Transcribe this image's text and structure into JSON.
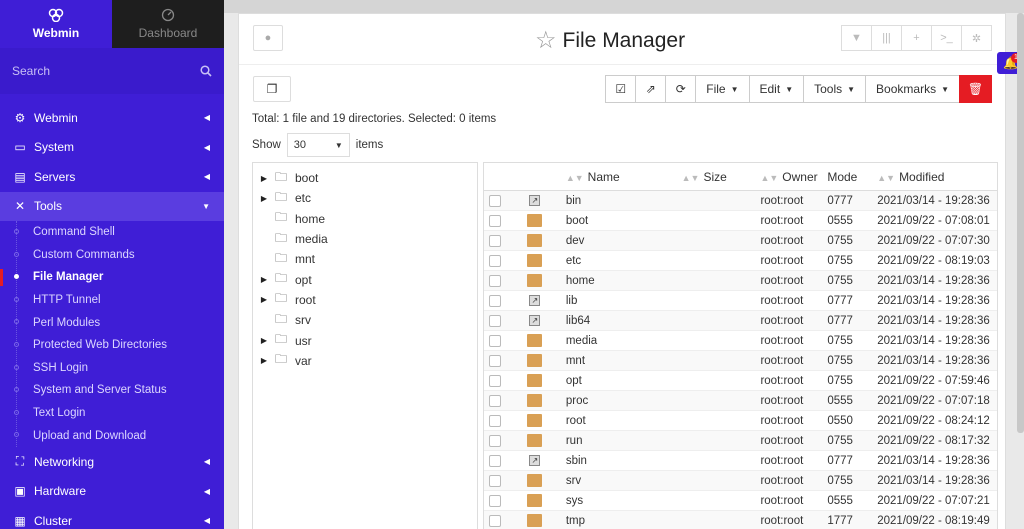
{
  "sidebar": {
    "top": [
      {
        "label": "Webmin",
        "active": true
      },
      {
        "label": "Dashboard",
        "active": false
      }
    ],
    "search_placeholder": "Search",
    "categories_top": [
      {
        "label": "Webmin",
        "icon": "gear-icon"
      },
      {
        "label": "System",
        "icon": "laptop-icon"
      },
      {
        "label": "Servers",
        "icon": "server-icon"
      }
    ],
    "tools_label": "Tools",
    "tools_items": [
      {
        "label": "Command Shell",
        "selected": false
      },
      {
        "label": "Custom Commands",
        "selected": false
      },
      {
        "label": "File Manager",
        "selected": true
      },
      {
        "label": "HTTP Tunnel",
        "selected": false
      },
      {
        "label": "Perl Modules",
        "selected": false
      },
      {
        "label": "Protected Web Directories",
        "selected": false
      },
      {
        "label": "SSH Login",
        "selected": false
      },
      {
        "label": "System and Server Status",
        "selected": false
      },
      {
        "label": "Text Login",
        "selected": false
      },
      {
        "label": "Upload and Download",
        "selected": false
      }
    ],
    "categories_bottom": [
      {
        "label": "Networking",
        "icon": "network-icon"
      },
      {
        "label": "Hardware",
        "icon": "hdd-icon"
      },
      {
        "label": "Cluster",
        "icon": "cluster-icon"
      }
    ]
  },
  "header": {
    "title": "File Manager"
  },
  "toolbar": {
    "file": "File",
    "edit": "Edit",
    "tools": "Tools",
    "bookmarks": "Bookmarks"
  },
  "summary": "Total: 1 file and 19 directories. Selected: 0 items",
  "show": {
    "prefix": "Show",
    "value": "30",
    "suffix": "items"
  },
  "tree": [
    {
      "name": "boot",
      "expandable": true
    },
    {
      "name": "etc",
      "expandable": true
    },
    {
      "name": "home",
      "expandable": false
    },
    {
      "name": "media",
      "expandable": false
    },
    {
      "name": "mnt",
      "expandable": false
    },
    {
      "name": "opt",
      "expandable": true
    },
    {
      "name": "root",
      "expandable": true
    },
    {
      "name": "srv",
      "expandable": false
    },
    {
      "name": "usr",
      "expandable": true
    },
    {
      "name": "var",
      "expandable": true
    }
  ],
  "columns": {
    "name": "Name",
    "size": "Size",
    "owner": "Owner",
    "mode": "Mode",
    "modified": "Modified"
  },
  "files": [
    {
      "type": "link",
      "name": "bin",
      "size": "",
      "owner": "root:root",
      "mode": "0777",
      "modified": "2021/03/14 - 19:28:36"
    },
    {
      "type": "folder",
      "name": "boot",
      "size": "",
      "owner": "root:root",
      "mode": "0555",
      "modified": "2021/09/22 - 07:08:01"
    },
    {
      "type": "folder",
      "name": "dev",
      "size": "",
      "owner": "root:root",
      "mode": "0755",
      "modified": "2021/09/22 - 07:07:30"
    },
    {
      "type": "folder",
      "name": "etc",
      "size": "",
      "owner": "root:root",
      "mode": "0755",
      "modified": "2021/09/22 - 08:19:03"
    },
    {
      "type": "folder",
      "name": "home",
      "size": "",
      "owner": "root:root",
      "mode": "0755",
      "modified": "2021/03/14 - 19:28:36"
    },
    {
      "type": "link",
      "name": "lib",
      "size": "",
      "owner": "root:root",
      "mode": "0777",
      "modified": "2021/03/14 - 19:28:36"
    },
    {
      "type": "link",
      "name": "lib64",
      "size": "",
      "owner": "root:root",
      "mode": "0777",
      "modified": "2021/03/14 - 19:28:36"
    },
    {
      "type": "folder",
      "name": "media",
      "size": "",
      "owner": "root:root",
      "mode": "0755",
      "modified": "2021/03/14 - 19:28:36"
    },
    {
      "type": "folder",
      "name": "mnt",
      "size": "",
      "owner": "root:root",
      "mode": "0755",
      "modified": "2021/03/14 - 19:28:36"
    },
    {
      "type": "folder",
      "name": "opt",
      "size": "",
      "owner": "root:root",
      "mode": "0755",
      "modified": "2021/09/22 - 07:59:46"
    },
    {
      "type": "folder",
      "name": "proc",
      "size": "",
      "owner": "root:root",
      "mode": "0555",
      "modified": "2021/09/22 - 07:07:18"
    },
    {
      "type": "folder",
      "name": "root",
      "size": "",
      "owner": "root:root",
      "mode": "0550",
      "modified": "2021/09/22 - 08:24:12"
    },
    {
      "type": "folder",
      "name": "run",
      "size": "",
      "owner": "root:root",
      "mode": "0755",
      "modified": "2021/09/22 - 08:17:32"
    },
    {
      "type": "link",
      "name": "sbin",
      "size": "",
      "owner": "root:root",
      "mode": "0777",
      "modified": "2021/03/14 - 19:28:36"
    },
    {
      "type": "folder",
      "name": "srv",
      "size": "",
      "owner": "root:root",
      "mode": "0755",
      "modified": "2021/03/14 - 19:28:36"
    },
    {
      "type": "folder",
      "name": "sys",
      "size": "",
      "owner": "root:root",
      "mode": "0555",
      "modified": "2021/09/22 - 07:07:21"
    },
    {
      "type": "folder",
      "name": "tmp",
      "size": "",
      "owner": "root:root",
      "mode": "1777",
      "modified": "2021/09/22 - 08:19:49"
    }
  ],
  "notifications": {
    "count": "1"
  },
  "colors": {
    "sidebar": "#3f1ed6",
    "danger": "#e51c23",
    "folder": "#d9a055"
  }
}
